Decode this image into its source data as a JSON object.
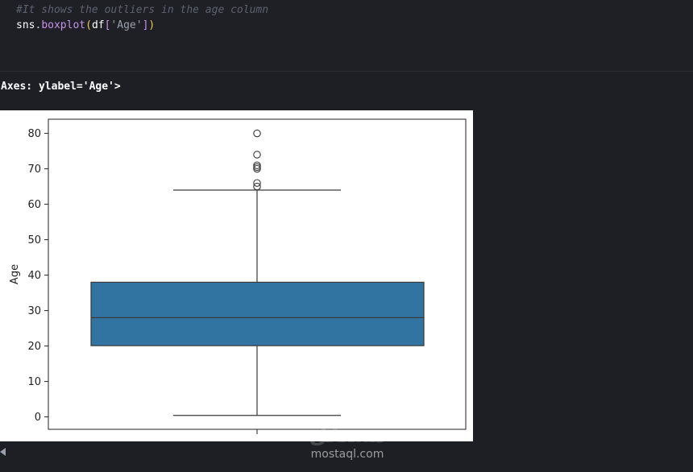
{
  "code": {
    "comment": "#It shows the outliers in the age column",
    "line2": {
      "var": "sns",
      "dot": ".",
      "func": "boxplot",
      "paren_open": "(",
      "arg": "df",
      "bracket_open": "[",
      "str": "'Age'",
      "bracket_close": "]",
      "paren_close": ")"
    }
  },
  "output": {
    "repr": "Axes: ylabel='Age'>"
  },
  "colors": {
    "box_fill": "#3274a1",
    "line": "#3a3a3a",
    "background": "#1e1f24"
  },
  "chart_data": {
    "type": "box",
    "ylabel": "Age",
    "ylim": [
      -3.5,
      84
    ],
    "yticks": [
      "0",
      "10",
      "20",
      "30",
      "40",
      "50",
      "60",
      "70",
      "80"
    ],
    "ytick_values": [
      0,
      10,
      20,
      30,
      40,
      50,
      60,
      70,
      80
    ],
    "box": {
      "whisker_low": 0.42,
      "q1": 20.1,
      "median": 28,
      "q3": 38,
      "whisker_high": 64
    },
    "outliers": [
      65,
      66,
      70,
      70.5,
      71,
      74,
      80
    ]
  },
  "watermark": {
    "logo": "مستقل",
    "text": "mostaql.com"
  }
}
